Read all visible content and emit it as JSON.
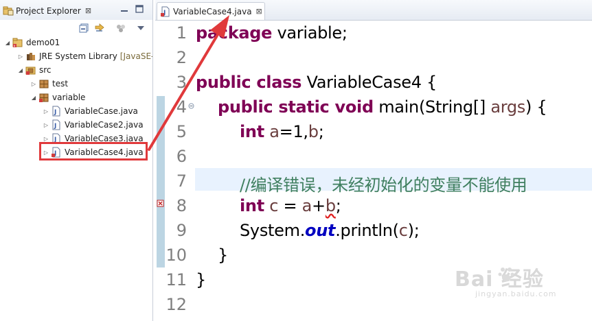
{
  "explorer": {
    "title": "Project Explorer",
    "close": "⊠",
    "tree": [
      {
        "label": "demo01",
        "suffix": "",
        "arrow": "◢",
        "icon": "project-icon"
      },
      {
        "label": "JRE System Library",
        "suffix": "[JavaSE-",
        "arrow": "▷",
        "icon": "library-icon"
      },
      {
        "label": "src",
        "suffix": "",
        "arrow": "◢",
        "icon": "source-folder-icon"
      },
      {
        "label": "test",
        "suffix": "",
        "arrow": "▷",
        "icon": "package-icon"
      },
      {
        "label": "variable",
        "suffix": "",
        "arrow": "◢",
        "icon": "package-icon"
      },
      {
        "label": "VariableCase.java",
        "suffix": "",
        "arrow": "▷",
        "icon": "java-file-icon"
      },
      {
        "label": "VariableCase2.java",
        "suffix": "",
        "arrow": "▷",
        "icon": "java-file-icon"
      },
      {
        "label": "VariableCase3.java",
        "suffix": "",
        "arrow": "▷",
        "icon": "java-file-icon"
      },
      {
        "label": "VariableCase4.java",
        "suffix": "",
        "arrow": "▷",
        "icon": "java-file-error-icon"
      }
    ]
  },
  "editor": {
    "tab_label": "VariableCase4.java",
    "close": "⊠",
    "line_numbers": [
      "1",
      "2",
      "3",
      "4",
      "5",
      "6",
      "7",
      "8",
      "9",
      "10",
      "11",
      "12"
    ],
    "tokens": {
      "l1_kw": "package",
      "l1_rest": " variable;",
      "l3_kw": "public class",
      "l3_rest": " VariableCase4 {",
      "l4_kw": "public static void",
      "l4_a": " main(String[] ",
      "l4_var": "args",
      "l4_b": ") {",
      "l5_kw": "int",
      "l5_a": " ",
      "l5_var1": "a",
      "l5_b": "=1,",
      "l5_var2": "b",
      "l5_c": ";",
      "l7_cmt": "//编译错误，未经初始化的变量不能使用",
      "l8_kw": "int",
      "l8_a": " ",
      "l8_var1": "c",
      "l8_b": " = ",
      "l8_var2": "a",
      "l8_c": "+",
      "l8_var3": "b",
      "l8_d": ";",
      "l9_a": "System.",
      "l9_fld": "out",
      "l9_b": ".println(",
      "l9_var": "c",
      "l9_c": ");",
      "l10": "}",
      "l11": "}"
    }
  },
  "watermark": {
    "brand": "Bai  经验",
    "url": "jingyan.baidu.com"
  },
  "colors": {
    "keyword": "#7f0055",
    "comment": "#3f7f5f",
    "field": "#0000c0",
    "annotation": "#e0393b"
  }
}
